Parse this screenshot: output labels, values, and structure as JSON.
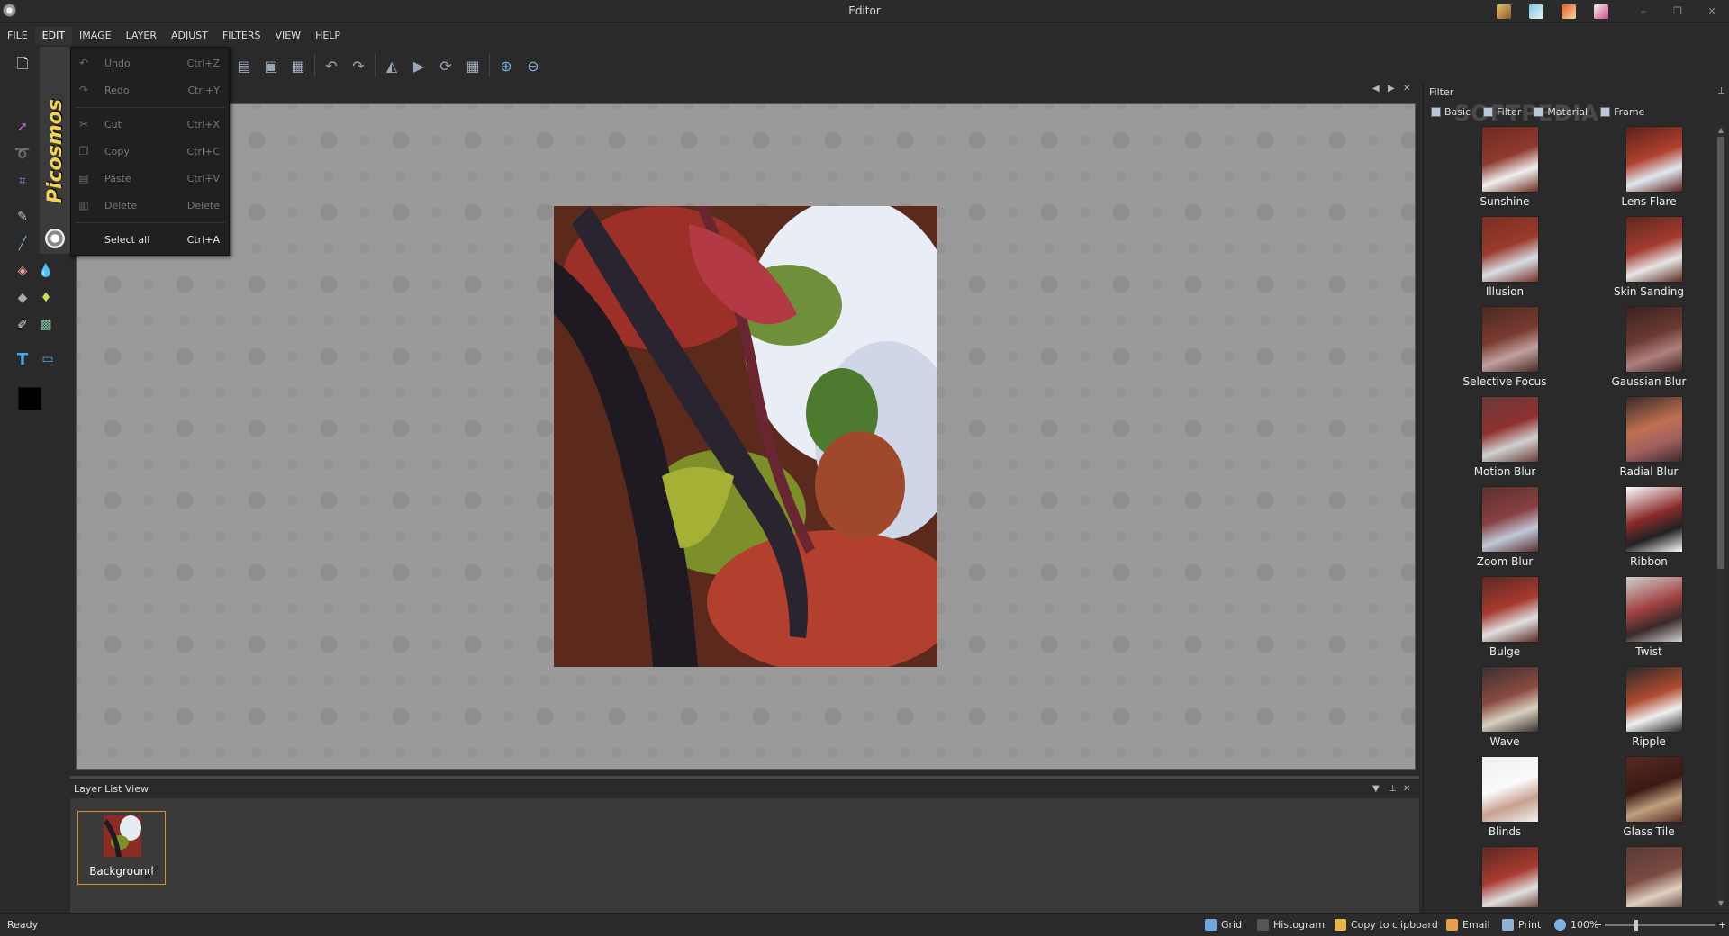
{
  "window": {
    "title": "Editor"
  },
  "menu": [
    "FILE",
    "EDIT",
    "IMAGE",
    "LAYER",
    "ADJUST",
    "FILTERS",
    "VIEW",
    "HELP"
  ],
  "active_menu": "EDIT",
  "brand": {
    "name": "Picosmos"
  },
  "edit_menu": [
    {
      "label": "Undo",
      "shortcut": "Ctrl+Z",
      "enabled": false,
      "icon": "undo-icon"
    },
    {
      "label": "Redo",
      "shortcut": "Ctrl+Y",
      "enabled": false,
      "icon": "redo-icon"
    },
    {
      "label": "Cut",
      "shortcut": "Ctrl+X",
      "enabled": false,
      "icon": "cut-icon"
    },
    {
      "label": "Copy",
      "shortcut": "Ctrl+C",
      "enabled": false,
      "icon": "copy-icon"
    },
    {
      "label": "Paste",
      "shortcut": "Ctrl+V",
      "enabled": false,
      "icon": "paste-icon"
    },
    {
      "label": "Delete",
      "shortcut": "Delete",
      "enabled": false,
      "icon": "delete-icon"
    },
    {
      "label": "Select all",
      "shortcut": "Ctrl+A",
      "enabled": true,
      "icon": ""
    }
  ],
  "layer_panel": {
    "title": "Layer List View",
    "layers": [
      {
        "name": "Background"
      }
    ]
  },
  "filter_panel": {
    "title": "Filter",
    "tabs": [
      "Basic",
      "Filter",
      "Material",
      "Frame"
    ],
    "watermark": "SOFTPEDIA",
    "items": [
      "Sunshine",
      "Lens Flare",
      "Illusion",
      "Skin Sanding",
      "Selective Focus",
      "Gaussian Blur",
      "Motion Blur",
      "Radial Blur",
      "Zoom Blur",
      "Ribbon",
      "Bulge",
      "Twist",
      "Wave",
      "Ripple",
      "Blinds",
      "Glass Tile",
      "",
      ""
    ]
  },
  "status": {
    "text": "Ready",
    "items": [
      {
        "label": "Grid",
        "icon": "grid-icon"
      },
      {
        "label": "Histogram",
        "icon": "histogram-icon"
      },
      {
        "label": "Copy to clipboard",
        "icon": "clipboard-icon"
      },
      {
        "label": "Email",
        "icon": "email-icon"
      },
      {
        "label": "Print",
        "icon": "print-icon"
      }
    ],
    "zoom": "100%",
    "zoom_minus": "−",
    "zoom_plus": "+"
  },
  "colors": {
    "accent": "#e08a2a",
    "foreground": "#000000",
    "background": "#ffffff"
  }
}
